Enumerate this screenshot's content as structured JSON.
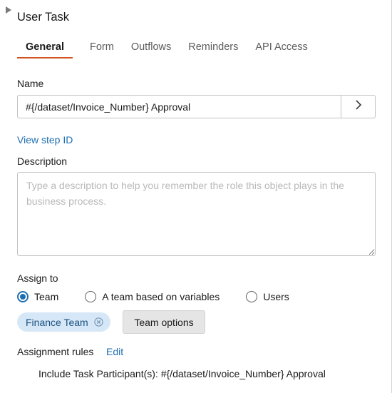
{
  "panel": {
    "title": "User Task"
  },
  "tabs": [
    {
      "label": "General",
      "active": true
    },
    {
      "label": "Form"
    },
    {
      "label": "Outflows"
    },
    {
      "label": "Reminders"
    },
    {
      "label": "API Access"
    }
  ],
  "name": {
    "label": "Name",
    "value": "#{/dataset/Invoice_Number} Approval",
    "expand_icon": "chevron-right-icon"
  },
  "view_step_id": "View step ID",
  "description": {
    "label": "Description",
    "placeholder": "Type a description to help you remember the role this object plays in the business process.",
    "value": ""
  },
  "assign": {
    "label": "Assign to",
    "options": [
      {
        "label": "Team",
        "selected": true
      },
      {
        "label": "A team based on variables",
        "selected": false
      },
      {
        "label": "Users",
        "selected": false
      }
    ],
    "selected_team": "Finance Team",
    "team_options_label": "Team options"
  },
  "assignment_rules": {
    "label": "Assignment rules",
    "edit_label": "Edit",
    "rule_label": "Include Task Participant(s):",
    "rule_value": "#{/dataset/Invoice_Number} Approval"
  },
  "colors": {
    "accent_link": "#1f6fb0",
    "tab_underline": "#d1501c",
    "pill_bg": "#d6e8f7"
  }
}
